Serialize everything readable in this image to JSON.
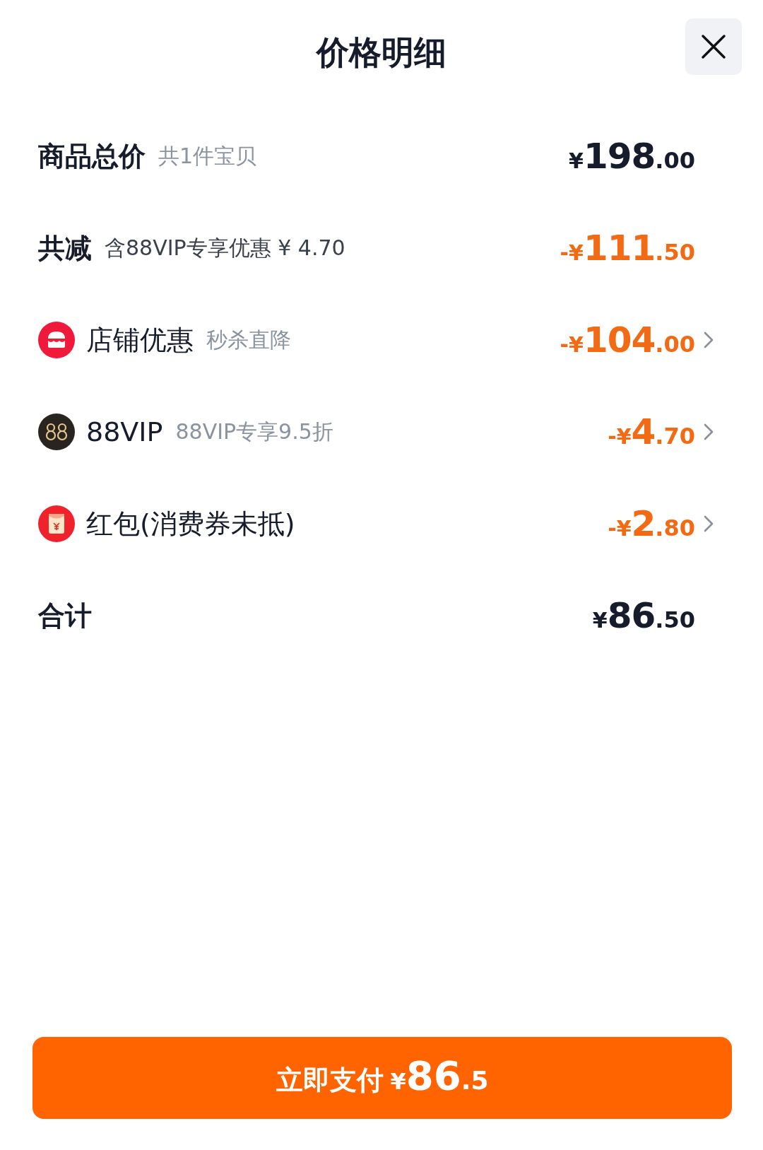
{
  "title": "价格明细",
  "rows": [
    {
      "kind": "summary",
      "label": "商品总价",
      "note": "共1件宝贝",
      "negative": false,
      "expandable": false,
      "amount": {
        "prefix": "¥",
        "whole": "198",
        "fraction": ".00"
      }
    },
    {
      "kind": "summary",
      "label": "共减",
      "note": "含88VIP专享优惠 ¥ 4.70",
      "negative": true,
      "expandable": false,
      "amount": {
        "prefix": "-¥",
        "whole": "111",
        "fraction": ".50"
      }
    },
    {
      "kind": "store",
      "label": "店铺优惠",
      "note": "秒杀直降",
      "negative": true,
      "expandable": true,
      "amount": {
        "prefix": "-¥",
        "whole": "104",
        "fraction": ".00"
      }
    },
    {
      "kind": "vip",
      "label": "88VIP",
      "note": "88VIP专享9.5折",
      "negative": true,
      "expandable": true,
      "amount": {
        "prefix": "-¥",
        "whole": "4",
        "fraction": ".70"
      }
    },
    {
      "kind": "packet",
      "label": "红包(消费券未抵)",
      "negative": true,
      "expandable": true,
      "amount": {
        "prefix": "-¥",
        "whole": "2",
        "fraction": ".80"
      }
    },
    {
      "kind": "summary",
      "label": "合计",
      "negative": false,
      "expandable": false,
      "amount": {
        "prefix": "¥",
        "whole": "86",
        "fraction": ".50"
      }
    }
  ],
  "pay_button": {
    "label": "立即支付",
    "amount": {
      "prefix": "¥",
      "whole": "86",
      "fraction": ".5"
    }
  }
}
